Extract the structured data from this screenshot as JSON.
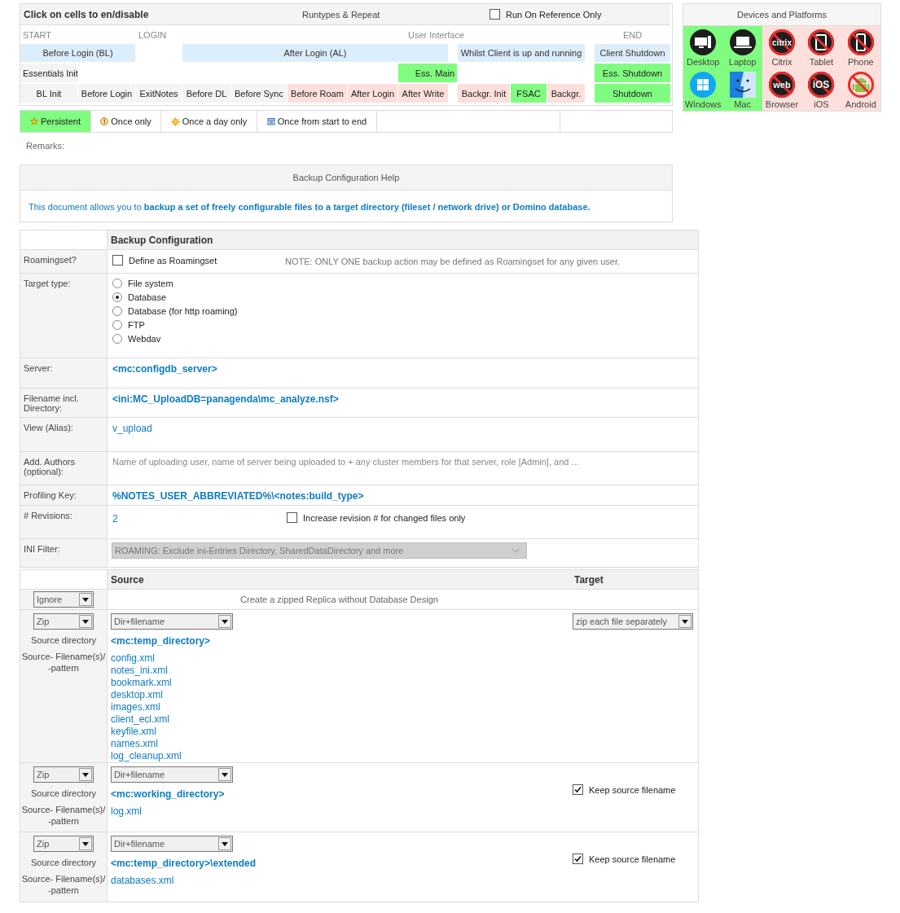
{
  "runtypes": {
    "title": "Click on cells to en/disable",
    "subtitle": "Runtypes & Repeat",
    "reference_only": {
      "label": "Run On Reference Only",
      "checked": false
    },
    "phases": [
      "START",
      "LOGIN",
      "User Interface",
      "END"
    ],
    "groups": [
      "Before Login (BL)",
      "After Login (AL)",
      "Whilst Client is up and running",
      "Client Shutdown"
    ],
    "essentials": [
      {
        "label": "Essentials Init",
        "kind": "fixed"
      },
      {
        "label": "Ess. Main",
        "kind": "toggle",
        "enabled": true
      },
      {
        "label": "Ess. Shutdown",
        "kind": "toggle",
        "enabled": true
      }
    ],
    "stages": [
      {
        "label": "BL Init",
        "kind": "fixed"
      },
      {
        "label": "Before Login",
        "kind": "fixed"
      },
      {
        "label": "ExitNotes",
        "kind": "fixed"
      },
      {
        "label": "Before DL",
        "kind": "fixed"
      },
      {
        "label": "Before Sync",
        "kind": "fixed"
      },
      {
        "label": "Before Roam",
        "kind": "toggle",
        "enabled": false
      },
      {
        "label": "After Login",
        "kind": "toggle",
        "enabled": false
      },
      {
        "label": "After Write",
        "kind": "toggle",
        "enabled": false
      },
      {
        "label": "Backgr. Init",
        "kind": "toggle",
        "enabled": false
      },
      {
        "label": "FSAC",
        "kind": "toggle",
        "enabled": true
      },
      {
        "label": "Backgr.",
        "kind": "toggle",
        "enabled": false
      },
      {
        "label": "Shutdown",
        "kind": "toggle",
        "enabled": true
      }
    ],
    "repeat": [
      {
        "label": "Persistent",
        "kind": "star",
        "selected": true
      },
      {
        "label": "Once only",
        "kind": "once",
        "selected": false
      },
      {
        "label": "Once a day only",
        "kind": "day",
        "selected": false
      },
      {
        "label": "Once from start to end",
        "kind": "session",
        "selected": false
      }
    ]
  },
  "remarks": "Remarks:",
  "devices": {
    "title": "Devices and Platforms",
    "items": [
      {
        "label": "Desktop",
        "kind": "desktop",
        "enabled": true
      },
      {
        "label": "Laptop",
        "kind": "laptop",
        "enabled": true
      },
      {
        "label": "Citrix",
        "kind": "citrix",
        "icon_text": "citrix",
        "enabled": false
      },
      {
        "label": "Tablet",
        "kind": "tablet",
        "enabled": false
      },
      {
        "label": "Phone",
        "kind": "phone",
        "enabled": false
      },
      {
        "label": "Windows",
        "kind": "windows",
        "enabled": true
      },
      {
        "label": "Mac",
        "kind": "mac",
        "enabled": true
      },
      {
        "label": "Browser",
        "kind": "browser",
        "icon_text": "web",
        "enabled": false
      },
      {
        "label": "iOS",
        "kind": "ios",
        "icon_text": "iOS",
        "enabled": false
      },
      {
        "label": "Android",
        "kind": "android",
        "enabled": false
      }
    ]
  },
  "help": {
    "title": "Backup Configuration Help",
    "text": "This document allows you to **backup a set of freely configurable files to a target directory (fileset / network drive) or Domino database.**"
  },
  "config": {
    "title": "Backup Configuration",
    "rows": [
      {
        "kind": "checkbox",
        "label": "Roamingset?",
        "option": {
          "label": "Define as Roamingset",
          "checked": false
        },
        "note": "NOTE: ONLY ONE backup action may be defined as Roamingset for any given user."
      },
      {
        "kind": "radios",
        "label": "Target type:",
        "options": [
          {
            "label": "File system",
            "selected": false
          },
          {
            "label": "Database",
            "selected": true
          },
          {
            "label": "Database (for http roaming)",
            "selected": false
          },
          {
            "label": "FTP",
            "selected": false
          },
          {
            "label": "Webdav",
            "selected": false
          }
        ]
      },
      {
        "kind": "value",
        "label": "Server:",
        "value": "<mc:configdb_server>",
        "emphasis": true
      },
      {
        "kind": "value",
        "label": "Filename incl.\nDirectory:",
        "value": "<ini:MC_UploadDB=panagenda\\mc_analyze.nsf>",
        "emphasis": true
      },
      {
        "kind": "value",
        "label": "View (Alias):",
        "value": "v_upload",
        "emphasis": false
      },
      {
        "kind": "hint",
        "label": "Add. Authors\n(optional):",
        "value": "Name of uploading user, name of server being uploaded to + any cluster members for that server, role [Admin], and ..."
      },
      {
        "kind": "value",
        "label": "Profiling Key:",
        "value": "%NOTES_USER_ABBREVIATED%\\<notes:build_type>",
        "emphasis": true
      },
      {
        "kind": "value_checkbox",
        "label": "# Revisions:",
        "value": "2",
        "option": {
          "label": "Increase revision # for changed files only",
          "checked": false
        }
      },
      {
        "kind": "select",
        "label": "INI Filter:",
        "value": "ROAMING: Exclude ini-Entries Directory, SharedDataDirectory and more",
        "disabled": true
      }
    ]
  },
  "sources": {
    "columns": [
      "Source",
      "Target"
    ],
    "rows": [
      {
        "kind": "note",
        "mode": "Ignore",
        "text": "Create a zipped Replica without Database Design"
      },
      {
        "kind": "entry",
        "mode": "Zip",
        "dir_label": "Source directory",
        "files_label": "Source- Filename(s)/\n-pattern",
        "source_mode": "Dir+filename",
        "directory": "<mc:temp_directory>",
        "files": [
          "config.xml",
          "notes_ini.xml",
          "bookmark.xml",
          "desktop.xml",
          "images.xml",
          "client_ecl.xml",
          "keyfile.xml",
          "names.xml",
          "log_cleanup.xml"
        ],
        "target": {
          "kind": "select",
          "value": "zip each file separately"
        }
      },
      {
        "kind": "entry",
        "mode": "Zip",
        "dir_label": "Source directory",
        "files_label": "Source- Filename(s)/\n-pattern",
        "source_mode": "Dir+filename",
        "directory": "<mc:working_directory>",
        "files": [
          "log.xml"
        ],
        "target": {
          "kind": "checkbox",
          "label": "Keep source filename",
          "checked": true
        }
      },
      {
        "kind": "entry",
        "mode": "Zip",
        "dir_label": "Source directory",
        "files_label": "Source- Filename(s)/\n-pattern",
        "source_mode": "Dir+filename",
        "directory": "<mc:temp_directory>\\extended",
        "files": [
          "databases.xml"
        ],
        "target": {
          "kind": "checkbox",
          "label": "Keep source filename",
          "checked": true
        }
      }
    ]
  }
}
